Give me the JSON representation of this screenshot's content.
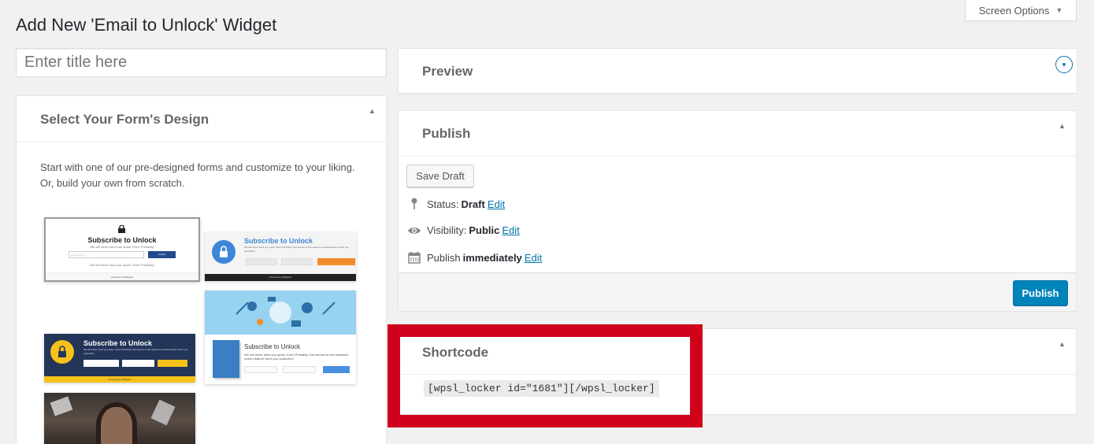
{
  "page": {
    "title": "Add New 'Email to Unlock' Widget"
  },
  "screen_options": {
    "label": "Screen Options"
  },
  "title_field": {
    "placeholder": "Enter title here"
  },
  "design": {
    "heading": "Select Your Form's Design",
    "description": "Start with one of our pre-designed forms and customize to your liking. Or, build your own from scratch.",
    "templates": [
      {
        "title": "Subscribe to Unlock",
        "sub": "We will never send you spam. Ever! Probably!",
        "input": "Email address",
        "button": "Unlock",
        "sub2": "We will never send you spam. Ever! Probably!",
        "footer": "powered by Mailoptin"
      },
      {
        "title": "Subscribe to Unlock",
        "sub": "We will never send you spam. Ever! Probably! Get access to this awesome locked feature when you subscribe!",
        "footer": "Powered by Mailoptin"
      },
      {
        "title": "Subscribe to Unlock",
        "sub": "We will never send you spam. Ever! Probably! Get access to this awesome locked feature when you subscribe!"
      },
      {
        "title": "Subscribe to Unlock",
        "sub": "We will never send you spam. Ever! Probably! Get access to this awesome locked feature when you subscribe!",
        "footer": "Powered by Mailoptin"
      },
      {
        "title": ""
      }
    ]
  },
  "preview": {
    "heading": "Preview"
  },
  "publish": {
    "heading": "Publish",
    "save_draft": "Save Draft",
    "status_label": "Status:",
    "status_value": "Draft",
    "visibility_label": "Visibility:",
    "visibility_value": "Public",
    "publish_label": "Publish",
    "publish_value": "immediately",
    "edit": "Edit",
    "publish_button": "Publish"
  },
  "shortcode": {
    "heading": "Shortcode",
    "value": "[wpsl_locker id=\"1681\"][/wpsl_locker]"
  },
  "colors": {
    "highlight": "#d0021b",
    "primary": "#0085ba",
    "link": "#0073aa"
  }
}
